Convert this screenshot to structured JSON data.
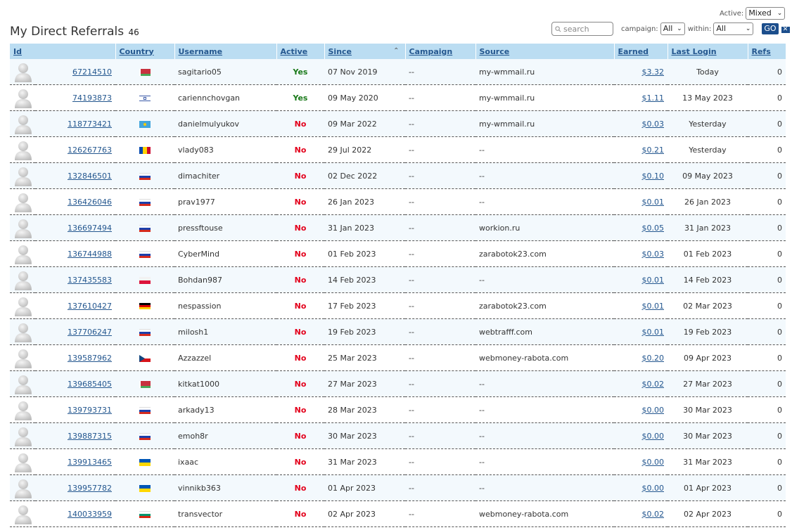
{
  "header": {
    "title": "My Direct Referrals",
    "count": "46"
  },
  "filters": {
    "active_label": "Active:",
    "active_value": "Mixed",
    "search_placeholder": "search",
    "campaign_label": "campaign:",
    "campaign_value": "All",
    "within_label": "within:",
    "within_value": "All",
    "go_label": "GO",
    "clear_label": "✕"
  },
  "columns": [
    "Id",
    "Country",
    "Username",
    "Active",
    "Since",
    "Campaign",
    "Source",
    "Earned",
    "Last Login",
    "Refs"
  ],
  "sort_indicator": "⌃",
  "referrals": [
    {
      "id": "67214510",
      "flag": "by",
      "username": "sagitario05",
      "active": "Yes",
      "since": "07 Nov 2019",
      "campaign": "--",
      "source": "my-wmmail.ru",
      "earned": "$3.32",
      "last_login": "Today",
      "refs": "0"
    },
    {
      "id": "74193873",
      "flag": "il",
      "username": "cariennchovgan",
      "active": "Yes",
      "since": "09 May 2020",
      "campaign": "--",
      "source": "my-wmmail.ru",
      "earned": "$1.11",
      "last_login": "13 May 2023",
      "refs": "0"
    },
    {
      "id": "118773421",
      "flag": "kz",
      "username": "danielmulyukov",
      "active": "No",
      "since": "09 Mar 2022",
      "campaign": "--",
      "source": "my-wmmail.ru",
      "earned": "$0.03",
      "last_login": "Yesterday",
      "refs": "0"
    },
    {
      "id": "126267763",
      "flag": "md",
      "username": "vlady083",
      "active": "No",
      "since": "29 Jul 2022",
      "campaign": "--",
      "source": "--",
      "earned": "$0.21",
      "last_login": "Yesterday",
      "refs": "0"
    },
    {
      "id": "132846501",
      "flag": "ru",
      "username": "dimachiter",
      "active": "No",
      "since": "02 Dec 2022",
      "campaign": "--",
      "source": "--",
      "earned": "$0.10",
      "last_login": "09 May 2023",
      "refs": "0"
    },
    {
      "id": "136426046",
      "flag": "ru",
      "username": "prav1977",
      "active": "No",
      "since": "26 Jan 2023",
      "campaign": "--",
      "source": "--",
      "earned": "$0.01",
      "last_login": "26 Jan 2023",
      "refs": "0"
    },
    {
      "id": "136697494",
      "flag": "ru",
      "username": "pressftouse",
      "active": "No",
      "since": "31 Jan 2023",
      "campaign": "--",
      "source": "workion.ru",
      "earned": "$0.05",
      "last_login": "31 Jan 2023",
      "refs": "0"
    },
    {
      "id": "136744988",
      "flag": "ru",
      "username": "CyberMind",
      "active": "No",
      "since": "01 Feb 2023",
      "campaign": "--",
      "source": "zarabotok23.com",
      "earned": "$0.03",
      "last_login": "01 Feb 2023",
      "refs": "0"
    },
    {
      "id": "137435583",
      "flag": "pl",
      "username": "Bohdan987",
      "active": "No",
      "since": "14 Feb 2023",
      "campaign": "--",
      "source": "--",
      "earned": "$0.01",
      "last_login": "14 Feb 2023",
      "refs": "0"
    },
    {
      "id": "137610427",
      "flag": "de",
      "username": "nespassion",
      "active": "No",
      "since": "17 Feb 2023",
      "campaign": "--",
      "source": "zarabotok23.com",
      "earned": "$0.01",
      "last_login": "02 Mar 2023",
      "refs": "0"
    },
    {
      "id": "137706247",
      "flag": "ru",
      "username": "milosh1",
      "active": "No",
      "since": "19 Feb 2023",
      "campaign": "--",
      "source": "webtrafff.com",
      "earned": "$0.01",
      "last_login": "19 Feb 2023",
      "refs": "0"
    },
    {
      "id": "139587962",
      "flag": "cz",
      "username": "Azzazzel",
      "active": "No",
      "since": "25 Mar 2023",
      "campaign": "--",
      "source": "webmoney-rabota.com",
      "earned": "$0.20",
      "last_login": "09 Apr 2023",
      "refs": "0"
    },
    {
      "id": "139685405",
      "flag": "by",
      "username": "kitkat1000",
      "active": "No",
      "since": "27 Mar 2023",
      "campaign": "--",
      "source": "--",
      "earned": "$0.02",
      "last_login": "27 Mar 2023",
      "refs": "0"
    },
    {
      "id": "139793731",
      "flag": "ru",
      "username": "arkady13",
      "active": "No",
      "since": "28 Mar 2023",
      "campaign": "--",
      "source": "--",
      "earned": "$0.00",
      "last_login": "30 Mar 2023",
      "refs": "0"
    },
    {
      "id": "139887315",
      "flag": "ru",
      "username": "emoh8r",
      "active": "No",
      "since": "30 Mar 2023",
      "campaign": "--",
      "source": "--",
      "earned": "$0.00",
      "last_login": "30 Mar 2023",
      "refs": "0"
    },
    {
      "id": "139913465",
      "flag": "ua",
      "username": "ixaac",
      "active": "No",
      "since": "31 Mar 2023",
      "campaign": "--",
      "source": "--",
      "earned": "$0.00",
      "last_login": "31 Mar 2023",
      "refs": "0"
    },
    {
      "id": "139957782",
      "flag": "ua",
      "username": "vinnikb363",
      "active": "No",
      "since": "01 Apr 2023",
      "campaign": "--",
      "source": "--",
      "earned": "$0.00",
      "last_login": "01 Apr 2023",
      "refs": "0"
    },
    {
      "id": "140033959",
      "flag": "bg",
      "username": "transvector",
      "active": "No",
      "since": "02 Apr 2023",
      "campaign": "--",
      "source": "webmoney-rabota.com",
      "earned": "$0.02",
      "last_login": "02 Apr 2023",
      "refs": "0"
    }
  ]
}
